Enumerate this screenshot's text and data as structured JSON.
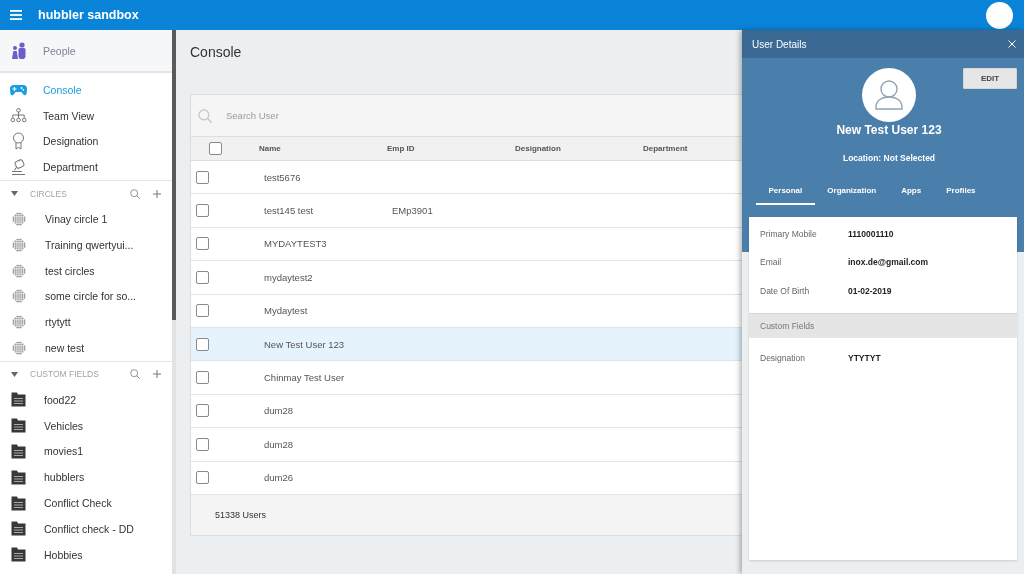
{
  "app_bar": {
    "title": "hubbler sandbox"
  },
  "sidebar": {
    "people": {
      "label": "People"
    },
    "nav": [
      {
        "label": "Console",
        "selected": true
      },
      {
        "label": "Team View",
        "selected": false
      },
      {
        "label": "Designation",
        "selected": false
      },
      {
        "label": "Department",
        "selected": false
      }
    ],
    "circles": {
      "title": "CIRCLES",
      "expanded": true,
      "items": [
        {
          "label": "Vinay circle 1"
        },
        {
          "label": "Training qwertyui..."
        },
        {
          "label": "test circles"
        },
        {
          "label": "some circle for so..."
        },
        {
          "label": "rtytytt"
        },
        {
          "label": "new test"
        }
      ]
    },
    "custom_fields": {
      "title": "CUSTOM FIELDS",
      "expanded": true,
      "items": [
        {
          "label": "food22"
        },
        {
          "label": "Vehicles"
        },
        {
          "label": "movies1"
        },
        {
          "label": "hubblers"
        },
        {
          "label": "Conflict Check"
        },
        {
          "label": "Conflict check - DD"
        },
        {
          "label": "Hobbies"
        }
      ]
    }
  },
  "main": {
    "title": "Console",
    "search": {
      "placeholder": "Search User"
    },
    "table": {
      "header_checked": false,
      "columns": [
        "Name",
        "Emp ID",
        "Designation",
        "Department"
      ],
      "rows": [
        {
          "name": "test5676",
          "selected": false,
          "checked": false
        },
        {
          "name": "test145 test",
          "emp_id": "EMp3901",
          "selected": false,
          "checked": false
        },
        {
          "name": "MYDAYTEST3",
          "selected": false,
          "checked": false
        },
        {
          "name": "mydaytest2",
          "selected": false,
          "checked": false
        },
        {
          "name": "Mydaytest",
          "selected": false,
          "checked": false
        },
        {
          "name": "New Test User 123",
          "selected": true,
          "checked": false
        },
        {
          "name": "Chinmay Test User",
          "selected": false,
          "checked": false
        },
        {
          "name": "dum28",
          "selected": false,
          "checked": false
        },
        {
          "name": "dum28",
          "selected": false,
          "checked": false
        },
        {
          "name": "dum26",
          "selected": false,
          "checked": false
        }
      ]
    },
    "footer": "51338 Users"
  },
  "panel": {
    "title": "User Details",
    "edit_button": "EDIT",
    "name": "New Test User 123",
    "location": "Location: Not Selected",
    "tabs": [
      {
        "label": "Personal",
        "selected": true
      },
      {
        "label": "Organization",
        "selected": false
      },
      {
        "label": "Apps",
        "selected": false
      },
      {
        "label": "Profiles",
        "selected": false
      }
    ],
    "fields": [
      {
        "label": "Primary Mobile",
        "value": "1110001110"
      },
      {
        "label": "Email",
        "value": "inox.de@gmail.com"
      },
      {
        "label": "Date Of Birth",
        "value": "01-02-2019"
      }
    ],
    "custom_fields_title": "Custom Fields",
    "custom_fields": [
      {
        "label": "Designation",
        "value": "YTYTYT"
      }
    ]
  }
}
